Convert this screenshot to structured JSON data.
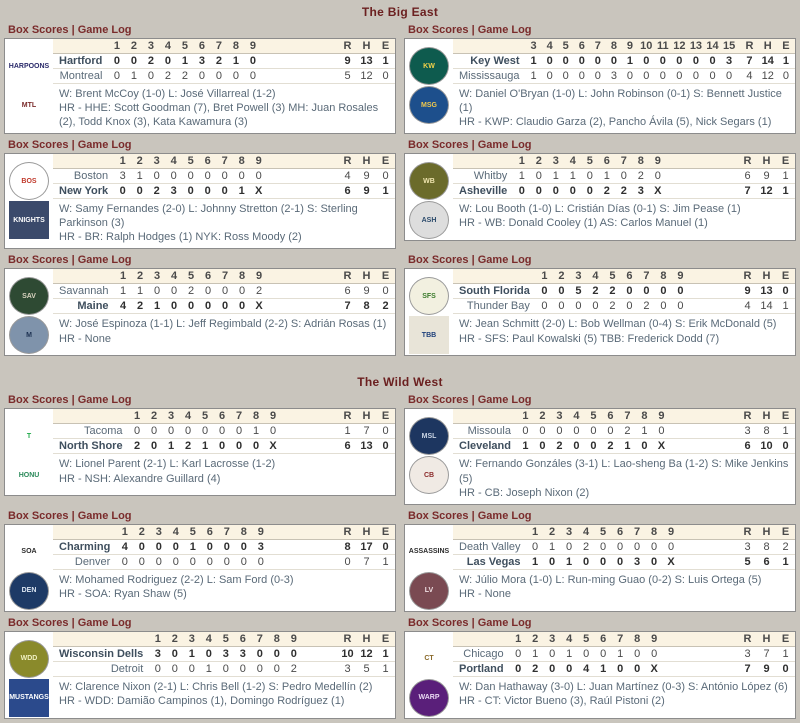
{
  "panel_links": {
    "box_scores": "Box Scores",
    "separator": "|",
    "game_log": "Game Log"
  },
  "rhe_headers": [
    "R",
    "H",
    "E"
  ],
  "leagues": [
    {
      "title": "The Big East",
      "games": [
        {
          "innings": [
            "1",
            "2",
            "3",
            "4",
            "5",
            "6",
            "7",
            "8",
            "9"
          ],
          "away": {
            "name": "Hartford",
            "logo_text": "HARPOONS",
            "logo_bg": "#ffffff",
            "logo_fg": "#2b2b6b",
            "logo_round": false,
            "line": [
              "0",
              "0",
              "2",
              "0",
              "1",
              "3",
              "2",
              "1",
              "0"
            ],
            "r": "9",
            "h": "13",
            "e": "1",
            "winner": true
          },
          "home": {
            "name": "Montreal",
            "logo_text": "MTL",
            "logo_bg": "#ffffff",
            "logo_fg": "#7a2b2b",
            "logo_round": false,
            "line": [
              "0",
              "1",
              "0",
              "2",
              "2",
              "0",
              "0",
              "0",
              "0"
            ],
            "r": "5",
            "h": "12",
            "e": "0",
            "winner": false
          },
          "decisions": "W: Brent McCoy (1-0) L: José Villarreal (1-2)",
          "homers": "HR - HHE: Scott Goodman (7), Bret Powell (3) MH: Juan Rosales (2), Todd Knox (3), Kata Kawamura (3)"
        },
        {
          "innings": [
            "3",
            "4",
            "5",
            "6",
            "7",
            "8",
            "9",
            "10",
            "11",
            "12",
            "13",
            "14",
            "15"
          ],
          "away": {
            "name": "Key West",
            "logo_text": "KW",
            "logo_bg": "#0e5b4e",
            "logo_fg": "#f2d24a",
            "logo_round": true,
            "line": [
              "1",
              "0",
              "0",
              "0",
              "0",
              "0",
              "1",
              "0",
              "0",
              "0",
              "0",
              "0",
              "3"
            ],
            "r": "7",
            "h": "14",
            "e": "1",
            "winner": true
          },
          "home": {
            "name": "Mississauga",
            "logo_text": "MSG",
            "logo_bg": "#1d4f8c",
            "logo_fg": "#f2c94c",
            "logo_round": true,
            "line": [
              "1",
              "0",
              "0",
              "0",
              "0",
              "3",
              "0",
              "0",
              "0",
              "0",
              "0",
              "0",
              "0"
            ],
            "r": "4",
            "h": "12",
            "e": "0",
            "winner": false
          },
          "decisions": "W: Daniel O'Bryan (1-0) L: John Robinson (0-1) S: Bennett Justice (1)",
          "homers": "HR - KWP: Claudio Garza (2), Pancho Ávila (5), Nick Segars (1)"
        },
        {
          "innings": [
            "1",
            "2",
            "3",
            "4",
            "5",
            "6",
            "7",
            "8",
            "9"
          ],
          "away": {
            "name": "Boston",
            "logo_text": "BOS",
            "logo_bg": "#ffffff",
            "logo_fg": "#c0392b",
            "logo_round": true,
            "line": [
              "3",
              "1",
              "0",
              "0",
              "0",
              "0",
              "0",
              "0",
              "0"
            ],
            "r": "4",
            "h": "9",
            "e": "0",
            "winner": false
          },
          "home": {
            "name": "New York",
            "logo_text": "KNIGHTS",
            "logo_bg": "#3b4a6b",
            "logo_fg": "#ffffff",
            "logo_round": false,
            "line": [
              "0",
              "0",
              "2",
              "3",
              "0",
              "0",
              "0",
              "1",
              "X"
            ],
            "r": "6",
            "h": "9",
            "e": "1",
            "winner": true
          },
          "decisions": "W: Samy Fernandes (2-0) L: Johnny Stretton (2-1) S: Sterling Parkinson (3)",
          "homers": "HR - BR: Ralph Hodges (1) NYK: Ross Moody (2)"
        },
        {
          "innings": [
            "1",
            "2",
            "3",
            "4",
            "5",
            "6",
            "7",
            "8",
            "9"
          ],
          "away": {
            "name": "Whitby",
            "logo_text": "WB",
            "logo_bg": "#6b6b2b",
            "logo_fg": "#f0e6b0",
            "logo_round": true,
            "line": [
              "1",
              "0",
              "1",
              "1",
              "0",
              "1",
              "0",
              "2",
              "0"
            ],
            "r": "6",
            "h": "9",
            "e": "1",
            "winner": false
          },
          "home": {
            "name": "Asheville",
            "logo_text": "ASH",
            "logo_bg": "#dddddd",
            "logo_fg": "#2b4a6b",
            "logo_round": true,
            "line": [
              "0",
              "0",
              "0",
              "0",
              "0",
              "2",
              "2",
              "3",
              "X"
            ],
            "r": "7",
            "h": "12",
            "e": "1",
            "winner": true
          },
          "decisions": "W: Lou Booth (1-0) L: Cristián Días (0-1) S: Jim Pease (1)",
          "homers": "HR - WB: Donald Cooley (1) AS: Carlos Manuel (1)"
        },
        {
          "innings": [
            "1",
            "2",
            "3",
            "4",
            "5",
            "6",
            "7",
            "8",
            "9"
          ],
          "away": {
            "name": "Savannah",
            "logo_text": "SAV",
            "logo_bg": "#2e4a33",
            "logo_fg": "#d8d2bf",
            "logo_round": true,
            "line": [
              "1",
              "1",
              "0",
              "0",
              "2",
              "0",
              "0",
              "0",
              "2"
            ],
            "r": "6",
            "h": "9",
            "e": "0",
            "winner": false
          },
          "home": {
            "name": "Maine",
            "logo_text": "M",
            "logo_bg": "#7f93ab",
            "logo_fg": "#1c3050",
            "logo_round": true,
            "line": [
              "4",
              "2",
              "1",
              "0",
              "0",
              "0",
              "0",
              "0",
              "X"
            ],
            "r": "7",
            "h": "8",
            "e": "2",
            "winner": true
          },
          "decisions": "W: José Espinoza (1-1) L: Jeff Regimbald (2-2) S: Adrián Rosas (1)",
          "homers": "HR - None"
        },
        {
          "innings": [
            "1",
            "2",
            "3",
            "4",
            "5",
            "6",
            "7",
            "8",
            "9"
          ],
          "away": {
            "name": "South Florida",
            "logo_text": "SFS",
            "logo_bg": "#f2f0e0",
            "logo_fg": "#3a7a2b",
            "logo_round": true,
            "line": [
              "0",
              "0",
              "5",
              "2",
              "2",
              "0",
              "0",
              "0",
              "0"
            ],
            "r": "9",
            "h": "13",
            "e": "0",
            "winner": true
          },
          "home": {
            "name": "Thunder Bay",
            "logo_text": "TBB",
            "logo_bg": "#e8e4d8",
            "logo_fg": "#1d3f7a",
            "logo_round": false,
            "line": [
              "0",
              "0",
              "0",
              "0",
              "2",
              "0",
              "2",
              "0",
              "0"
            ],
            "r": "4",
            "h": "14",
            "e": "1",
            "winner": false
          },
          "decisions": "W: Jean Schmitt (2-0) L: Bob Wellman (0-4) S: Erik McDonald (5)",
          "homers": "HR - SFS: Paul Kowalski (5) TBB: Frederick Dodd (7)"
        }
      ]
    },
    {
      "title": "The Wild West",
      "games": [
        {
          "innings": [
            "1",
            "2",
            "3",
            "4",
            "5",
            "6",
            "7",
            "8",
            "9"
          ],
          "away": {
            "name": "Tacoma",
            "logo_text": "T",
            "logo_bg": "#ffffff",
            "logo_fg": "#1faa4a",
            "logo_round": false,
            "line": [
              "0",
              "0",
              "0",
              "0",
              "0",
              "0",
              "0",
              "1",
              "0"
            ],
            "r": "1",
            "h": "7",
            "e": "0",
            "winner": false
          },
          "home": {
            "name": "North Shore",
            "logo_text": "HONU",
            "logo_bg": "#ffffff",
            "logo_fg": "#2b8a5a",
            "logo_round": false,
            "line": [
              "2",
              "0",
              "1",
              "2",
              "1",
              "0",
              "0",
              "0",
              "X"
            ],
            "r": "6",
            "h": "13",
            "e": "0",
            "winner": true
          },
          "decisions": "W: Lionel Parent (2-1) L: Karl Lacrosse (1-2)",
          "homers": "HR - NSH: Alexandre Guillard (4)"
        },
        {
          "innings": [
            "1",
            "2",
            "3",
            "4",
            "5",
            "6",
            "7",
            "8",
            "9"
          ],
          "away": {
            "name": "Missoula",
            "logo_text": "MSL",
            "logo_bg": "#1d3660",
            "logo_fg": "#c9d4e4",
            "logo_round": true,
            "line": [
              "0",
              "0",
              "0",
              "0",
              "0",
              "0",
              "2",
              "1",
              "0"
            ],
            "r": "3",
            "h": "8",
            "e": "1",
            "winner": false
          },
          "home": {
            "name": "Cleveland",
            "logo_text": "CB",
            "logo_bg": "#f0eae4",
            "logo_fg": "#8c2b2b",
            "logo_round": true,
            "line": [
              "1",
              "0",
              "2",
              "0",
              "0",
              "2",
              "1",
              "0",
              "X"
            ],
            "r": "6",
            "h": "10",
            "e": "0",
            "winner": true
          },
          "decisions": "W: Fernando Gonzáles (3-1) L: Lao-sheng Ba (1-2) S: Mike Jenkins (5)",
          "homers": "HR - CB: Joseph Nixon (2)"
        },
        {
          "innings": [
            "1",
            "2",
            "3",
            "4",
            "5",
            "6",
            "7",
            "8",
            "9"
          ],
          "away": {
            "name": "Charming",
            "logo_text": "SOA",
            "logo_bg": "#ffffff",
            "logo_fg": "#2b2b2b",
            "logo_round": false,
            "line": [
              "4",
              "0",
              "0",
              "0",
              "1",
              "0",
              "0",
              "0",
              "3"
            ],
            "r": "8",
            "h": "17",
            "e": "0",
            "winner": true
          },
          "home": {
            "name": "Denver",
            "logo_text": "DEN",
            "logo_bg": "#1d3a66",
            "logo_fg": "#dce6f2",
            "logo_round": true,
            "line": [
              "0",
              "0",
              "0",
              "0",
              "0",
              "0",
              "0",
              "0",
              "0"
            ],
            "r": "0",
            "h": "7",
            "e": "1",
            "winner": false
          },
          "decisions": "W: Mohamed Rodriguez (2-2) L: Sam Ford (0-3)",
          "homers": "HR - SOA: Ryan Shaw (5)"
        },
        {
          "innings": [
            "1",
            "2",
            "3",
            "4",
            "5",
            "6",
            "7",
            "8",
            "9"
          ],
          "away": {
            "name": "Death Valley",
            "logo_text": "ASSASSINS",
            "logo_bg": "#ffffff",
            "logo_fg": "#2b2b2b",
            "logo_round": false,
            "line": [
              "0",
              "1",
              "0",
              "2",
              "0",
              "0",
              "0",
              "0",
              "0"
            ],
            "r": "3",
            "h": "8",
            "e": "2",
            "winner": false
          },
          "home": {
            "name": "Las Vegas",
            "logo_text": "LV",
            "logo_bg": "#7a4a52",
            "logo_fg": "#f0e0e4",
            "logo_round": true,
            "line": [
              "1",
              "0",
              "1",
              "0",
              "0",
              "0",
              "3",
              "0",
              "X"
            ],
            "r": "5",
            "h": "6",
            "e": "1",
            "winner": true
          },
          "decisions": "W: Júlio Mora (1-0) L: Run-ming Guao (0-2) S: Luis Ortega (5)",
          "homers": "HR - None"
        },
        {
          "innings": [
            "1",
            "2",
            "3",
            "4",
            "5",
            "6",
            "7",
            "8",
            "9"
          ],
          "away": {
            "name": "Wisconsin Dells",
            "logo_text": "WDD",
            "logo_bg": "#8a8a2b",
            "logo_fg": "#f0f0c0",
            "logo_round": true,
            "line": [
              "3",
              "0",
              "1",
              "0",
              "3",
              "3",
              "0",
              "0",
              "0"
            ],
            "r": "10",
            "h": "12",
            "e": "1",
            "winner": true
          },
          "home": {
            "name": "Detroit",
            "logo_text": "MUSTANGS",
            "logo_bg": "#2b4a8c",
            "logo_fg": "#ffffff",
            "logo_round": false,
            "line": [
              "0",
              "0",
              "0",
              "1",
              "0",
              "0",
              "0",
              "0",
              "2"
            ],
            "r": "3",
            "h": "5",
            "e": "1",
            "winner": false
          },
          "decisions": "W: Clarence Nixon (2-1) L: Chris Bell (1-2) S: Pedro Medellín (2)",
          "homers": "HR - WDD: Damião Campinos (1), Domingo Rodríguez (1)"
        },
        {
          "innings": [
            "1",
            "2",
            "3",
            "4",
            "5",
            "6",
            "7",
            "8",
            "9"
          ],
          "away": {
            "name": "Chicago",
            "logo_text": "CT",
            "logo_bg": "#ffffff",
            "logo_fg": "#8a6a2b",
            "logo_round": false,
            "line": [
              "0",
              "1",
              "0",
              "1",
              "0",
              "0",
              "1",
              "0",
              "0"
            ],
            "r": "3",
            "h": "7",
            "e": "1",
            "winner": false
          },
          "home": {
            "name": "Portland",
            "logo_text": "WARP",
            "logo_bg": "#5a1f7a",
            "logo_fg": "#e8d8f2",
            "logo_round": true,
            "line": [
              "0",
              "2",
              "0",
              "0",
              "4",
              "1",
              "0",
              "0",
              "X"
            ],
            "r": "7",
            "h": "9",
            "e": "0",
            "winner": true
          },
          "decisions": "W: Dan Hathaway (3-0) L: Juan Martínez (0-3) S: António López (6)",
          "homers": "HR - CT: Victor Bueno (3), Raúl Pistoni (2)"
        }
      ]
    }
  ]
}
